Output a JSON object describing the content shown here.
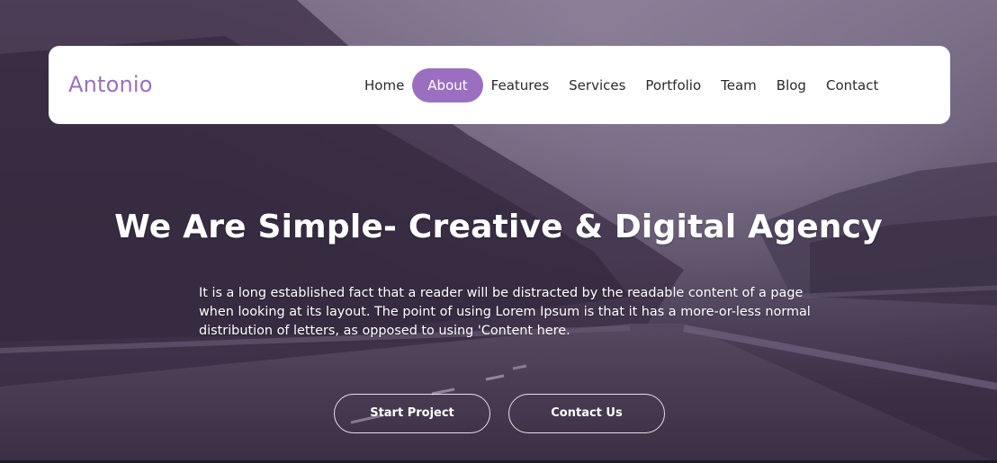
{
  "brand": {
    "name": "Antonio"
  },
  "nav": {
    "items": [
      {
        "label": "Home",
        "active": false
      },
      {
        "label": "About",
        "active": true
      },
      {
        "label": "Features",
        "active": false
      },
      {
        "label": "Services",
        "active": false
      },
      {
        "label": "Portfolio",
        "active": false
      },
      {
        "label": "Team",
        "active": false
      },
      {
        "label": "Blog",
        "active": false
      },
      {
        "label": "Contact",
        "active": false
      }
    ]
  },
  "hero": {
    "title": "We Are Simple- Creative & Digital Agency",
    "description": "It is a long established fact that a reader will be distracted by the readable content of a page when looking at its layout. The point of using Lorem Ipsum is that it has a more-or-less normal distribution of letters, as opposed to using 'Content here.",
    "buttons": {
      "start_project": "Start Project",
      "contact_us": "Contact Us"
    }
  },
  "colors": {
    "accent": "#9a6fc0",
    "navbar_bg": "#ffffff",
    "hero_overlay": "#4f4559"
  }
}
